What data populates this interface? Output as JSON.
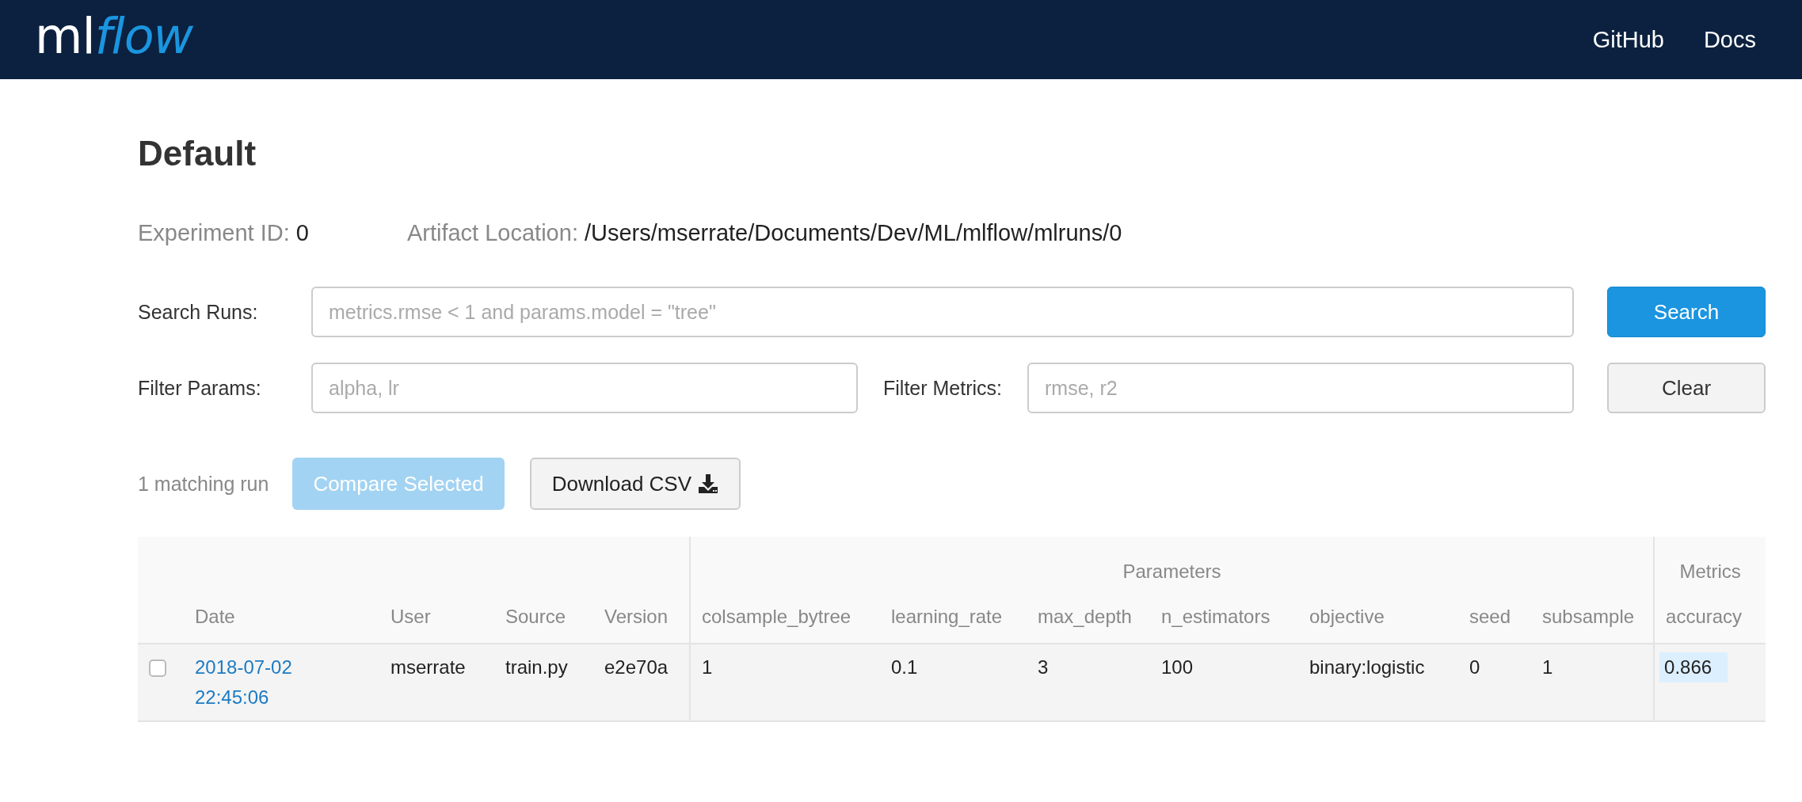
{
  "header": {
    "logo": {
      "prefix": "ml",
      "suffix": "flow"
    },
    "links": [
      "GitHub",
      "Docs"
    ]
  },
  "experiment": {
    "title": "Default",
    "id_label": "Experiment ID:",
    "id": "0",
    "artifact_label": "Artifact Location:",
    "artifact": "/Users/mserrate/Documents/Dev/ML/mlflow/mlruns/0"
  },
  "search": {
    "label": "Search Runs:",
    "placeholder": "metrics.rmse < 1 and params.model = \"tree\"",
    "button": "Search"
  },
  "filters": {
    "params_label": "Filter Params:",
    "params_placeholder": "alpha, lr",
    "metrics_label": "Filter Metrics:",
    "metrics_placeholder": "rmse, r2",
    "clear_button": "Clear"
  },
  "runs_toolbar": {
    "count": "1 matching run",
    "compare_button": {
      "label": "Compare Selected",
      "disabled": true
    },
    "download_button": "Download CSV"
  },
  "table": {
    "param_group": "Parameters",
    "metric_group": "Metrics",
    "base_columns": [
      "Date",
      "User",
      "Source",
      "Version"
    ],
    "param_columns": [
      "colsample_bytree",
      "learning_rate",
      "max_depth",
      "n_estimators",
      "objective",
      "seed",
      "subsample"
    ],
    "metric_columns": [
      "accuracy"
    ],
    "rows": [
      {
        "selected": false,
        "date": "2018-07-02 22:45:06",
        "user": "mserrate",
        "source": "train.py",
        "version": "e2e70a",
        "params": [
          "1",
          "0.1",
          "3",
          "100",
          "binary:logistic",
          "0",
          "1"
        ],
        "metrics": [
          "0.866"
        ]
      }
    ]
  }
}
